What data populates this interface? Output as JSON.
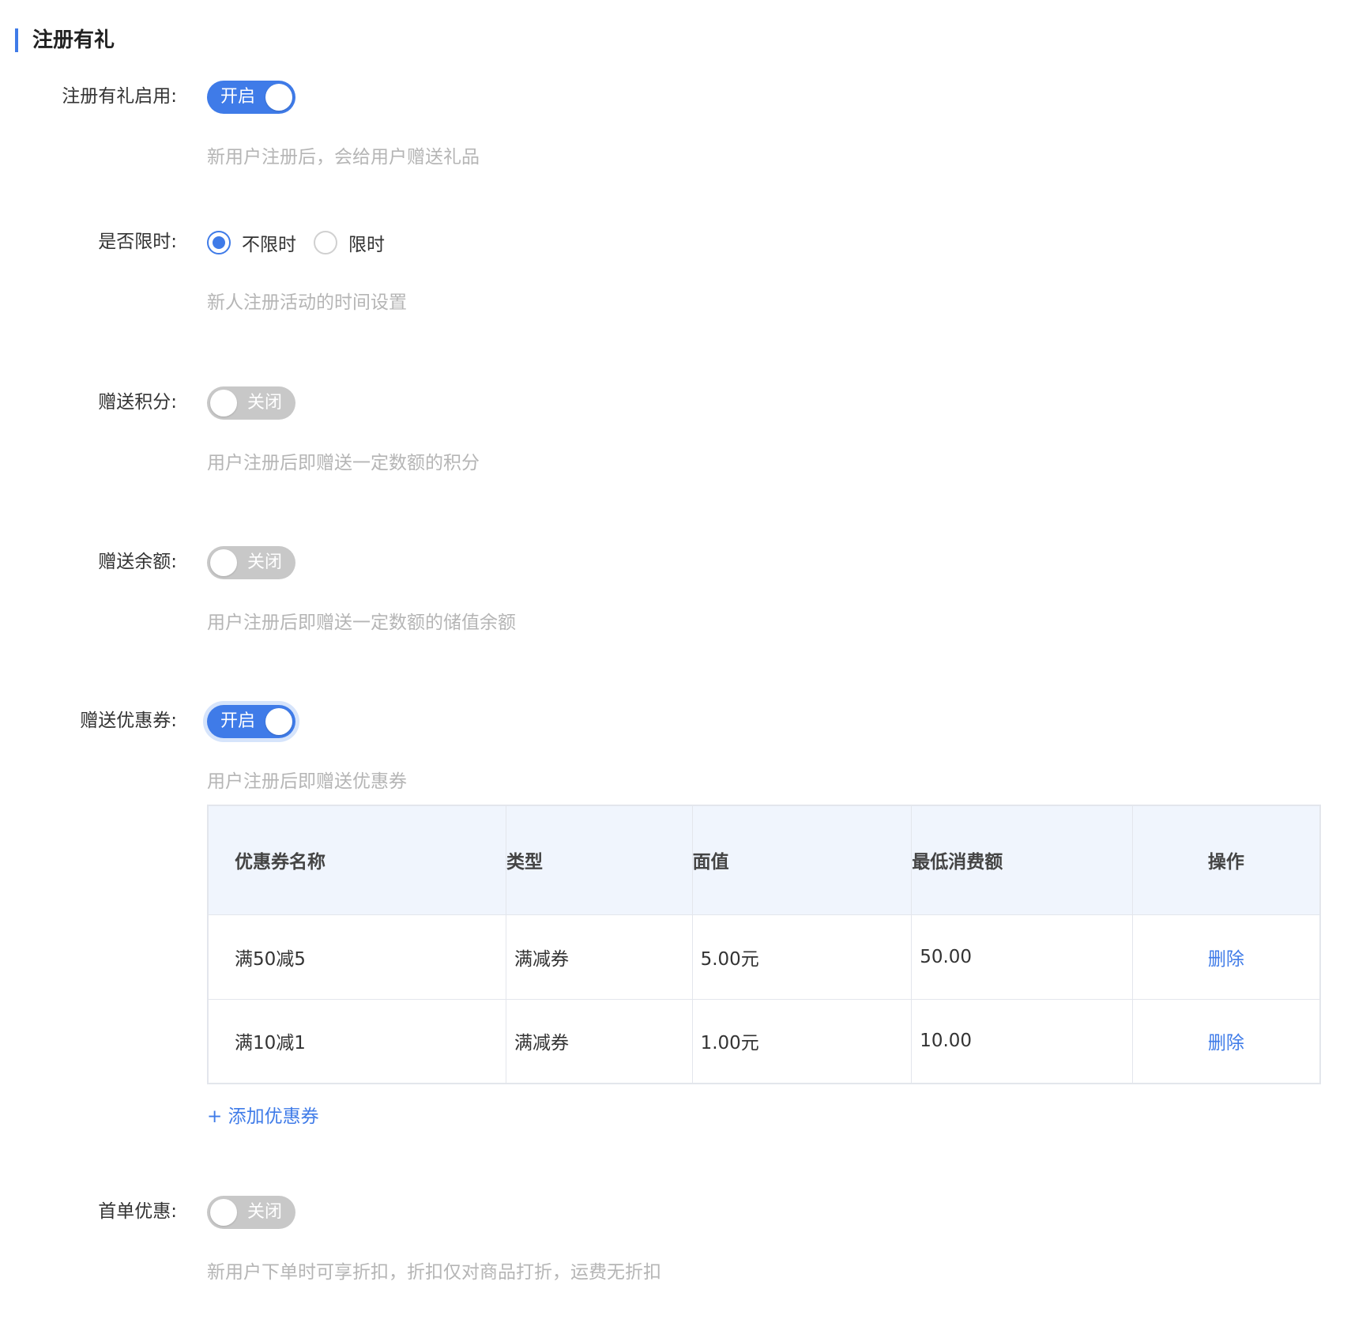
{
  "section": {
    "title": "注册有礼"
  },
  "enable": {
    "label": "注册有礼启用:",
    "switch": {
      "state": "on",
      "text": "开启"
    },
    "hint": "新用户注册后，会给用户赠送礼品"
  },
  "time_limit": {
    "label": "是否限时:",
    "options": [
      {
        "label": "不限时",
        "checked": true
      },
      {
        "label": "限时",
        "checked": false
      }
    ],
    "hint": "新人注册活动的时间设置"
  },
  "points": {
    "label": "赠送积分:",
    "switch": {
      "state": "off",
      "text": "关闭"
    },
    "hint": "用户注册后即赠送一定数额的积分"
  },
  "balance": {
    "label": "赠送余额:",
    "switch": {
      "state": "off",
      "text": "关闭"
    },
    "hint": "用户注册后即赠送一定数额的储值余额"
  },
  "coupons": {
    "label": "赠送优惠券:",
    "switch": {
      "state": "on",
      "text": "开启"
    },
    "hint": "用户注册后即赠送优惠券",
    "table": {
      "headers": [
        "优惠券名称",
        "类型",
        "面值",
        "最低消费额",
        "操作"
      ],
      "rows": [
        {
          "name": "满50减5",
          "type": "满减券",
          "value": "5.00元",
          "min": "50.00",
          "action": "删除"
        },
        {
          "name": "满10减1",
          "type": "满减券",
          "value": "1.00元",
          "min": "10.00",
          "action": "删除"
        }
      ]
    },
    "add_label": "+ 添加优惠券"
  },
  "first_order": {
    "label": "首单优惠:",
    "switch": {
      "state": "off",
      "text": "关闭"
    },
    "hint": "新用户下单时可享折扣，折扣仅对商品打折，运费无折扣"
  },
  "colors": {
    "accent": "#3f7be8",
    "switch_off": "#c8c8c8",
    "hint": "#b5b5b5",
    "table_header_bg": "#f0f5fd"
  }
}
